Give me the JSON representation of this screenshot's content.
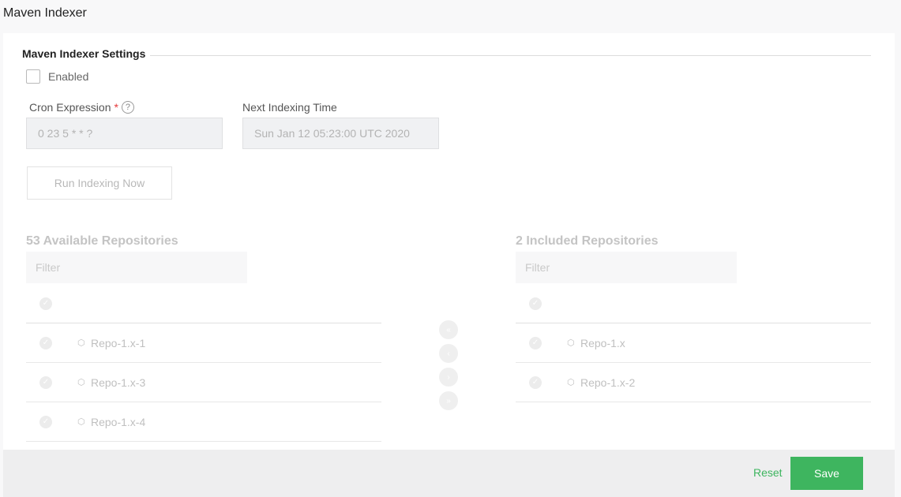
{
  "page": {
    "title": "Maven Indexer"
  },
  "settings": {
    "section_title": "Maven Indexer Settings",
    "enabled_label": "Enabled",
    "enabled_checked": false,
    "cron_label": "Cron Expression",
    "required_mark": "*",
    "help_glyph": "?",
    "cron_value": "0 23 5 * * ?",
    "next_time_label": "Next Indexing Time",
    "next_time_value": "Sun Jan 12 05:23:00 UTC 2020",
    "run_button": "Run Indexing Now"
  },
  "available": {
    "heading": "53 Available Repositories",
    "filter_placeholder": "Filter",
    "items": [
      {
        "name": "Repo-1.x-1"
      },
      {
        "name": "Repo-1.x-3"
      },
      {
        "name": "Repo-1.x-4"
      }
    ]
  },
  "included": {
    "heading": "2 Included Repositories",
    "filter_placeholder": "Filter",
    "items": [
      {
        "name": "Repo-1.x"
      },
      {
        "name": "Repo-1.x-2"
      }
    ]
  },
  "transfer": {
    "buttons": [
      "«",
      "‹",
      "›",
      "»"
    ]
  },
  "footer": {
    "reset_label": "Reset",
    "save_label": "Save"
  },
  "colors": {
    "accent": "#3eb55f",
    "required": "#e5393b"
  }
}
